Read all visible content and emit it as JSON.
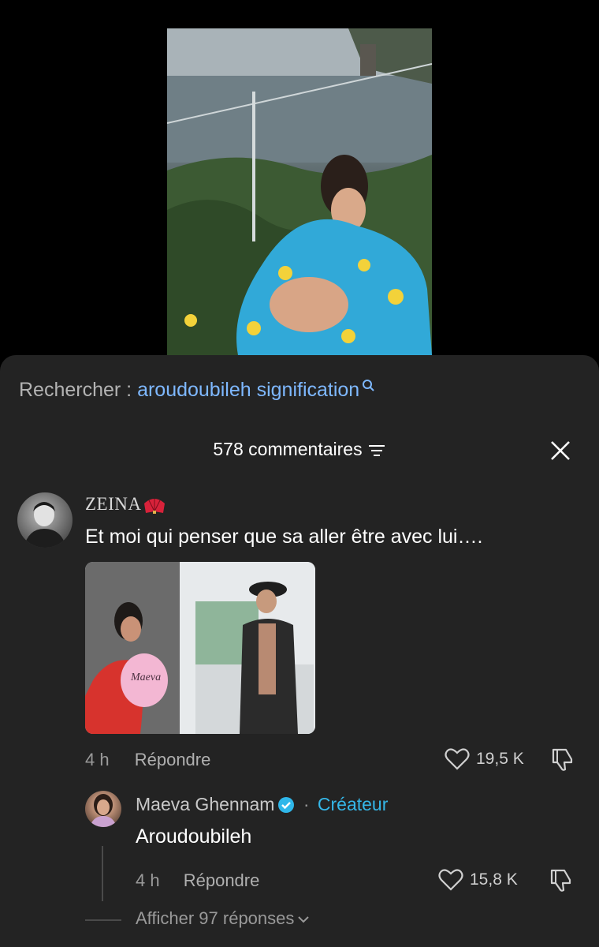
{
  "search": {
    "prefix": "Rechercher : ",
    "term": "aroudoubileh signification",
    "icon": "search-icon"
  },
  "comments_header": {
    "count_label": "578 commentaires",
    "sort_icon": "filter-lines-icon",
    "close_icon": "close-icon"
  },
  "comment": {
    "username": "ZEINA",
    "username_icon": "folding-fan-icon",
    "text": "Et moi qui penser que sa aller être avec lui….",
    "image_text": "Maeva",
    "time": "4 h",
    "reply_label": "Répondre",
    "likes": "19,5 K"
  },
  "reply": {
    "username": "Maeva Ghennam",
    "separator": "·",
    "badge": "Créateur",
    "text": "Aroudoubileh",
    "time": "4 h",
    "reply_label": "Répondre",
    "likes": "15,8 K"
  },
  "more_replies": {
    "label": "Afficher 97 réponses"
  },
  "colors": {
    "sheet_bg": "#232323",
    "link_blue": "#7eb8ff",
    "creator_blue": "#35b7e8"
  }
}
